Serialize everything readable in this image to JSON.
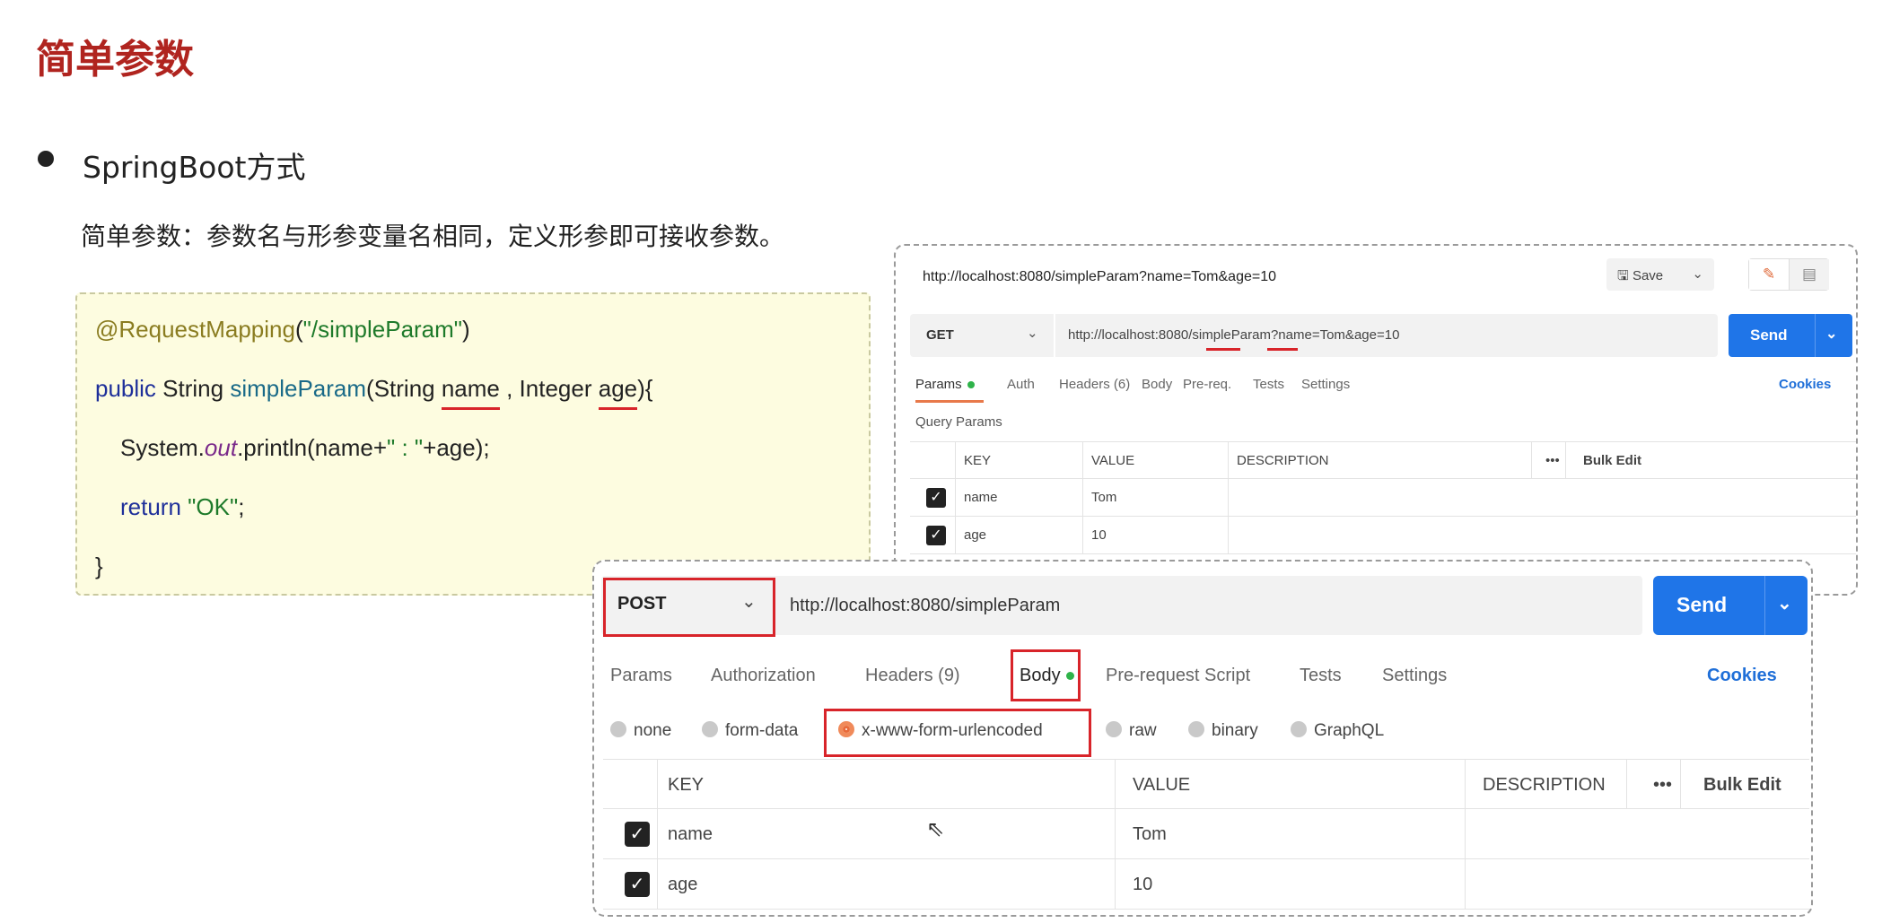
{
  "slide": {
    "title": "简单参数",
    "bullet": "SpringBoot方式",
    "description": "简单参数：参数名与形参变量名相同，定义形参即可接收参数。"
  },
  "code": {
    "line1_ann": "@RequestMapping",
    "line1_paren_open": "(",
    "line1_str": "\"/simpleParam\"",
    "line1_paren_close": ")",
    "line2_kw": "public",
    "line2_type": " String ",
    "line2_method": "simpleParam",
    "line2_a": "(String ",
    "line2_name": "name",
    "line2_b": " , Integer ",
    "line2_age": "age",
    "line2_c": "){",
    "line3_a": "System.",
    "line3_out": "out",
    "line3_b": ".println(name+",
    "line3_str": "\" : \"",
    "line3_c": "+age);",
    "line4_kw": "return",
    "line4_str": "\"OK\"",
    "line4_end": ";",
    "line5": "}"
  },
  "get_panel": {
    "title_url": "http://localhost:8080/simpleParam?name=Tom&age=10",
    "save_label": "Save",
    "method": "GET",
    "url_prefix": "http://localhost:8080/simpleParam?",
    "url_name": "name",
    "url_mid": "=Tom&",
    "url_age": "age",
    "url_suffix": "=10",
    "send_label": "Send",
    "tabs": [
      "Params",
      "Auth",
      "Headers (6)",
      "Body",
      "Pre-req.",
      "Tests",
      "Settings"
    ],
    "cookies": "Cookies",
    "query_params_label": "Query Params",
    "columns": [
      "KEY",
      "VALUE",
      "DESCRIPTION",
      "•••",
      "Bulk Edit"
    ],
    "rows": [
      {
        "key": "name",
        "value": "Tom"
      },
      {
        "key": "age",
        "value": "10"
      }
    ]
  },
  "post_panel": {
    "method": "POST",
    "url": "http://localhost:8080/simpleParam",
    "send_label": "Send",
    "tabs": [
      "Params",
      "Authorization",
      "Headers (9)",
      "Body",
      "Pre-request Script",
      "Tests",
      "Settings"
    ],
    "cookies": "Cookies",
    "body_types": [
      "none",
      "form-data",
      "x-www-form-urlencoded",
      "raw",
      "binary",
      "GraphQL"
    ],
    "selected_body_type": "x-www-form-urlencoded",
    "columns": [
      "KEY",
      "VALUE",
      "DESCRIPTION",
      "•••",
      "Bulk Edit"
    ],
    "rows": [
      {
        "key": "name",
        "value": "Tom"
      },
      {
        "key": "age",
        "value": "10"
      }
    ]
  },
  "colors": {
    "title_red": "#b0241f",
    "send_blue": "#1f75e8",
    "highlight_red": "#d8242a",
    "active_orange": "#e8794a",
    "status_green": "#2fb34a"
  }
}
